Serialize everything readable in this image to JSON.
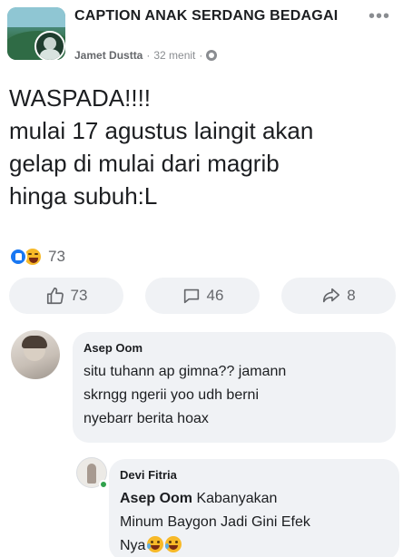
{
  "post": {
    "group_name": "CAPTION ANAK SERDANG BEDAGAI",
    "author": "Jamet Dustta",
    "separator": "·",
    "time": "32 menit",
    "more": "•••",
    "text_lines": [
      "WASPADA!!!!",
      "mulai 17 agustus laingit akan",
      "gelap di mulai dari magrib",
      "hinga subuh:L"
    ],
    "reactions": {
      "icons": [
        "like-icon",
        "haha-icon"
      ],
      "count": "73"
    },
    "actions": {
      "likes": "73",
      "comments": "46",
      "shares": "8"
    }
  },
  "comment": {
    "name": "Asep Oom",
    "lines": [
      "situ tuhann ap gimna?? jamann",
      "skrngg ngerii yoo udh berni",
      "nyebarr berita hoax"
    ]
  },
  "reply": {
    "name": "Devi Fitria",
    "mention": "Asep Oom",
    "line1_rest": " Kabanyakan",
    "line2": "Minum Baygon Jadi Gini Efek",
    "line3": "Nya",
    "emojis": [
      "tears-of-joy-emoji",
      "crying-laughing-emoji"
    ]
  },
  "colors": {
    "accent": "#1877f2",
    "bubble": "#f0f2f5",
    "muted": "#65676b",
    "online": "#31a24c"
  }
}
